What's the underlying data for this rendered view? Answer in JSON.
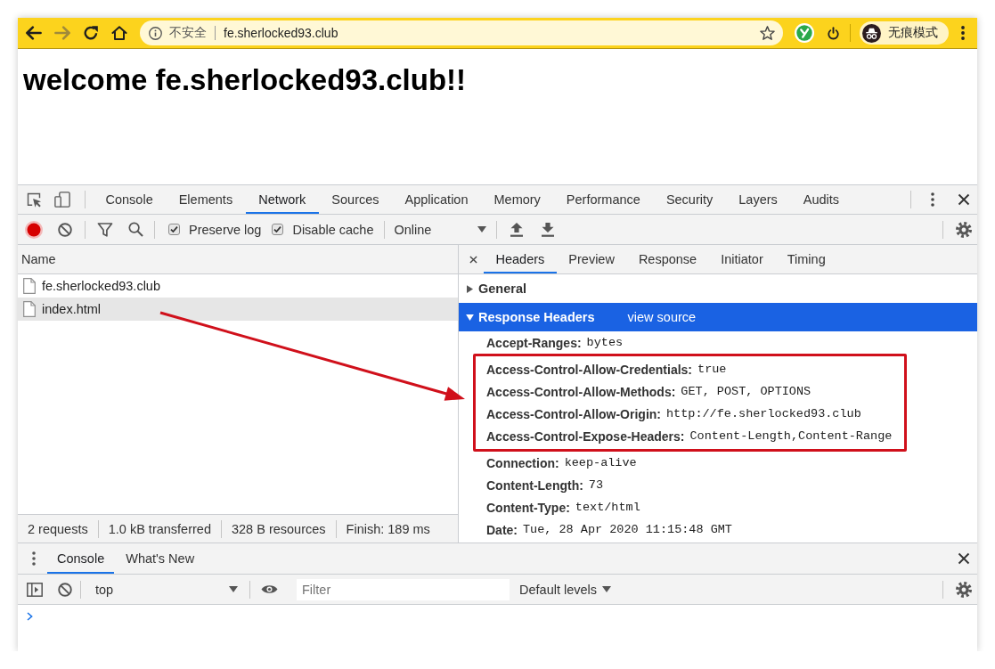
{
  "browser": {
    "nav_buttons": [
      {
        "kind": "back",
        "disabled": false
      },
      {
        "kind": "forward",
        "disabled": true
      },
      {
        "kind": "reload",
        "disabled": false
      },
      {
        "kind": "home",
        "disabled": false
      }
    ],
    "address_bar": {
      "security_label": "不安全",
      "url": "fe.sherlocked93.club"
    },
    "profile": {
      "label": "无痕模式"
    }
  },
  "page": {
    "heading": "welcome fe.sherlocked93.club!!"
  },
  "devtools": {
    "tabs": [
      {
        "label": "Console",
        "selected": false
      },
      {
        "label": "Elements",
        "selected": false
      },
      {
        "label": "Network",
        "selected": true
      },
      {
        "label": "Sources",
        "selected": false
      },
      {
        "label": "Application",
        "selected": false
      },
      {
        "label": "Memory",
        "selected": false
      },
      {
        "label": "Performance",
        "selected": false
      },
      {
        "label": "Security",
        "selected": false
      },
      {
        "label": "Layers",
        "selected": false
      },
      {
        "label": "Audits",
        "selected": false
      }
    ],
    "recording": true,
    "options": [
      {
        "label": "Preserve log",
        "checked": true
      },
      {
        "label": "Disable cache",
        "checked": true
      }
    ],
    "throttling": "Online",
    "requests": {
      "column": "Name",
      "rows": [
        {
          "name": "fe.sherlocked93.club",
          "selected": false
        },
        {
          "name": "index.html",
          "selected": true
        }
      ],
      "summary": [
        "2 requests",
        "1.0 kB transferred",
        "328 B resources",
        "Finish: 189 ms"
      ]
    },
    "detail": {
      "tabs": [
        {
          "label": "Headers",
          "selected": true
        },
        {
          "label": "Preview",
          "selected": false
        },
        {
          "label": "Response",
          "selected": false
        },
        {
          "label": "Initiator",
          "selected": false
        },
        {
          "label": "Timing",
          "selected": false
        }
      ],
      "sections": [
        {
          "title": "General",
          "expanded": false,
          "selected": false
        },
        {
          "title": "Response Headers",
          "expanded": true,
          "selected": true,
          "link": "view source",
          "headers": [
            {
              "name": "Accept-Ranges:",
              "value": "bytes",
              "highlighted": false
            },
            {
              "name": "Access-Control-Allow-Credentials:",
              "value": "true",
              "highlighted": true
            },
            {
              "name": "Access-Control-Allow-Methods:",
              "value": "GET, POST, OPTIONS",
              "highlighted": true
            },
            {
              "name": "Access-Control-Allow-Origin:",
              "value": "http://fe.sherlocked93.club",
              "highlighted": true
            },
            {
              "name": "Access-Control-Expose-Headers:",
              "value": "Content-Length,Content-Range",
              "highlighted": true
            },
            {
              "name": "Connection:",
              "value": "keep-alive",
              "highlighted": false
            },
            {
              "name": "Content-Length:",
              "value": "73",
              "highlighted": false
            },
            {
              "name": "Content-Type:",
              "value": "text/html",
              "highlighted": false
            },
            {
              "name": "Date:",
              "value": "Tue, 28 Apr 2020 11:15:48 GMT",
              "highlighted": false
            }
          ]
        }
      ]
    }
  },
  "drawer": {
    "tabs": [
      {
        "label": "Console",
        "selected": true
      },
      {
        "label": "What's New",
        "selected": false
      }
    ],
    "context": "top",
    "filter": {
      "placeholder": "Filter"
    },
    "levels": "Default levels"
  }
}
